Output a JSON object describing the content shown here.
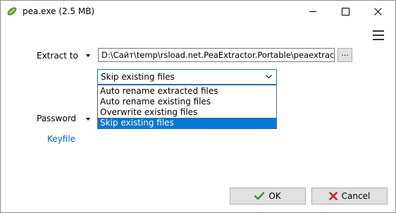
{
  "window": {
    "title": "pea.exe (2.5 MB)"
  },
  "icons": {
    "app": "pea-pod-icon",
    "minimize": "minimize-icon",
    "maximize": "maximize-icon",
    "close": "close-icon",
    "menu": "hamburger-menu-icon",
    "browse": "ellipsis",
    "combo_chevron": "chevron-down-icon",
    "ok": "checkmark-icon",
    "cancel": "x-icon"
  },
  "form": {
    "extract_label": "Extract to",
    "extract_path": "D:\\Сайт\\temp\\rsload.net.PeaExtractor.Portable\\peaextractor-po",
    "browse_label": "...",
    "overwrite_selected": "Skip existing files",
    "overwrite_options": [
      "Auto rename extracted files",
      "Auto rename existing files",
      "Overwrite existing files",
      "Skip existing files"
    ],
    "overwrite_selected_index": 3,
    "password_label": "Password",
    "keyfile_label": "Keyfile"
  },
  "buttons": {
    "ok": "OK",
    "cancel": "Cancel"
  },
  "colors": {
    "accent": "#0078d7",
    "link": "#0066cc",
    "ok_check": "#2e9e2e",
    "cancel_x": "#d21f1f",
    "app_icon": "#5aa02c"
  }
}
